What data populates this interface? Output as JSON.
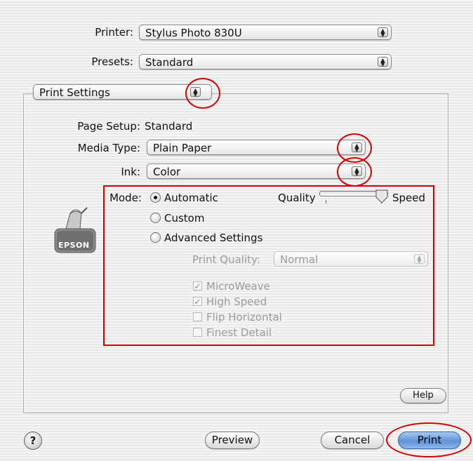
{
  "printer": {
    "label": "Printer:",
    "value": "Stylus Photo 830U"
  },
  "presets": {
    "label": "Presets:",
    "value": "Standard"
  },
  "panel_menu": {
    "value": "Print Settings"
  },
  "page_setup": {
    "label": "Page Setup:",
    "value": "Standard"
  },
  "media_type": {
    "label": "Media Type:",
    "value": "Plain Paper"
  },
  "ink": {
    "label": "Ink:",
    "value": "Color"
  },
  "mode": {
    "label": "Mode:",
    "options": [
      "Automatic",
      "Custom",
      "Advanced Settings"
    ],
    "selected": "Automatic",
    "slider": {
      "left_label": "Quality",
      "right_label": "Speed",
      "position_fraction": 1.0
    }
  },
  "advanced": {
    "print_quality": {
      "label": "Print Quality:",
      "value": "Normal"
    },
    "checkboxes": [
      {
        "label": "MicroWeave",
        "checked": true
      },
      {
        "label": "High Speed",
        "checked": true
      },
      {
        "label": "Flip Horizontal",
        "checked": false
      },
      {
        "label": "Finest Detail",
        "checked": false
      }
    ]
  },
  "logo": {
    "text": "EPSON"
  },
  "buttons": {
    "help": "Help",
    "help_icon": "?",
    "preview": "Preview",
    "cancel": "Cancel",
    "print": "Print"
  },
  "colors": {
    "highlight": "#d40000",
    "default_button": "#5f93d6"
  }
}
